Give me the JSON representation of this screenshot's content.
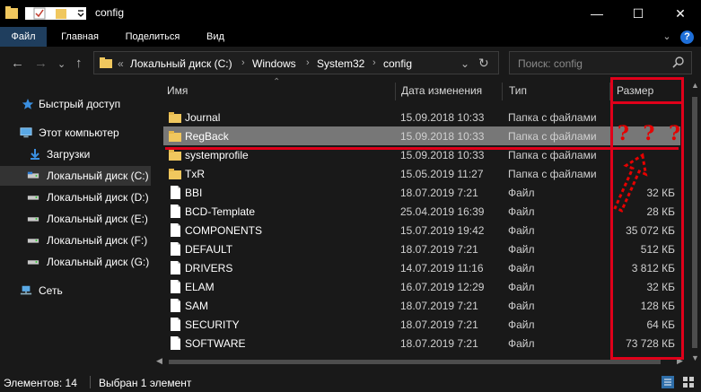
{
  "window": {
    "title": "config",
    "minimize": "—",
    "maximize": "☐",
    "close": "✕"
  },
  "ribbon": {
    "tabs": [
      {
        "label": "Файл",
        "active": true
      },
      {
        "label": "Главная"
      },
      {
        "label": "Поделиться"
      },
      {
        "label": "Вид"
      }
    ],
    "expand": "⌄",
    "help": "?"
  },
  "address": {
    "overflow": "«",
    "crumbs": [
      "Локальный диск (C:)",
      "Windows",
      "System32",
      "config"
    ],
    "dropdown": "⌄",
    "refresh": "↻"
  },
  "search": {
    "placeholder": "Поиск: config"
  },
  "nav_pane": {
    "items": [
      {
        "label": "Быстрый доступ",
        "icon": "star-icon"
      },
      {
        "label": "Этот компьютер",
        "icon": "computer-icon"
      },
      {
        "label": "Загрузки",
        "icon": "download-icon"
      },
      {
        "label": "Локальный диск (C:)",
        "icon": "drive-icon",
        "selected": true
      },
      {
        "label": "Локальный диск (D:)",
        "icon": "drive-icon"
      },
      {
        "label": "Локальный диск (E:)",
        "icon": "drive-icon"
      },
      {
        "label": "Локальный диск (F:)",
        "icon": "drive-icon"
      },
      {
        "label": "Локальный диск (G:)",
        "icon": "drive-icon"
      },
      {
        "label": "Сеть",
        "icon": "network-icon"
      }
    ]
  },
  "columns": {
    "name": "Имя",
    "date": "Дата изменения",
    "type": "Тип",
    "size": "Размер"
  },
  "files": [
    {
      "name": "Journal",
      "date": "15.09.2018 10:33",
      "type": "Папка с файлами",
      "size": "",
      "kind": "folder"
    },
    {
      "name": "RegBack",
      "date": "15.09.2018 10:33",
      "type": "Папка с файлами",
      "size": "",
      "kind": "folder",
      "selected": true
    },
    {
      "name": "systemprofile",
      "date": "15.09.2018 10:33",
      "type": "Папка с файлами",
      "size": "",
      "kind": "folder"
    },
    {
      "name": "TxR",
      "date": "15.05.2019 11:27",
      "type": "Папка с файлами",
      "size": "",
      "kind": "folder"
    },
    {
      "name": "BBI",
      "date": "18.07.2019 7:21",
      "type": "Файл",
      "size": "32 КБ",
      "kind": "file"
    },
    {
      "name": "BCD-Template",
      "date": "25.04.2019 16:39",
      "type": "Файл",
      "size": "28 КБ",
      "kind": "file"
    },
    {
      "name": "COMPONENTS",
      "date": "15.07.2019 19:42",
      "type": "Файл",
      "size": "35 072 КБ",
      "kind": "file"
    },
    {
      "name": "DEFAULT",
      "date": "18.07.2019 7:21",
      "type": "Файл",
      "size": "512 КБ",
      "kind": "file"
    },
    {
      "name": "DRIVERS",
      "date": "14.07.2019 11:16",
      "type": "Файл",
      "size": "3 812 КБ",
      "kind": "file"
    },
    {
      "name": "ELAM",
      "date": "16.07.2019 12:29",
      "type": "Файл",
      "size": "32 КБ",
      "kind": "file"
    },
    {
      "name": "SAM",
      "date": "18.07.2019 7:21",
      "type": "Файл",
      "size": "128 КБ",
      "kind": "file"
    },
    {
      "name": "SECURITY",
      "date": "18.07.2019 7:21",
      "type": "Файл",
      "size": "64 КБ",
      "kind": "file"
    },
    {
      "name": "SOFTWARE",
      "date": "18.07.2019 7:21",
      "type": "Файл",
      "size": "73 728 КБ",
      "kind": "file"
    }
  ],
  "status": {
    "count": "Элементов: 14",
    "selection": "Выбран 1 элемент"
  },
  "annotation": {
    "marks": "? ? ?",
    "color": "#e0001a"
  },
  "colors": {
    "background": "#191919",
    "selected_row": "#777777",
    "folder": "#f0c75e",
    "accent_tab": "#1f3e5e"
  }
}
